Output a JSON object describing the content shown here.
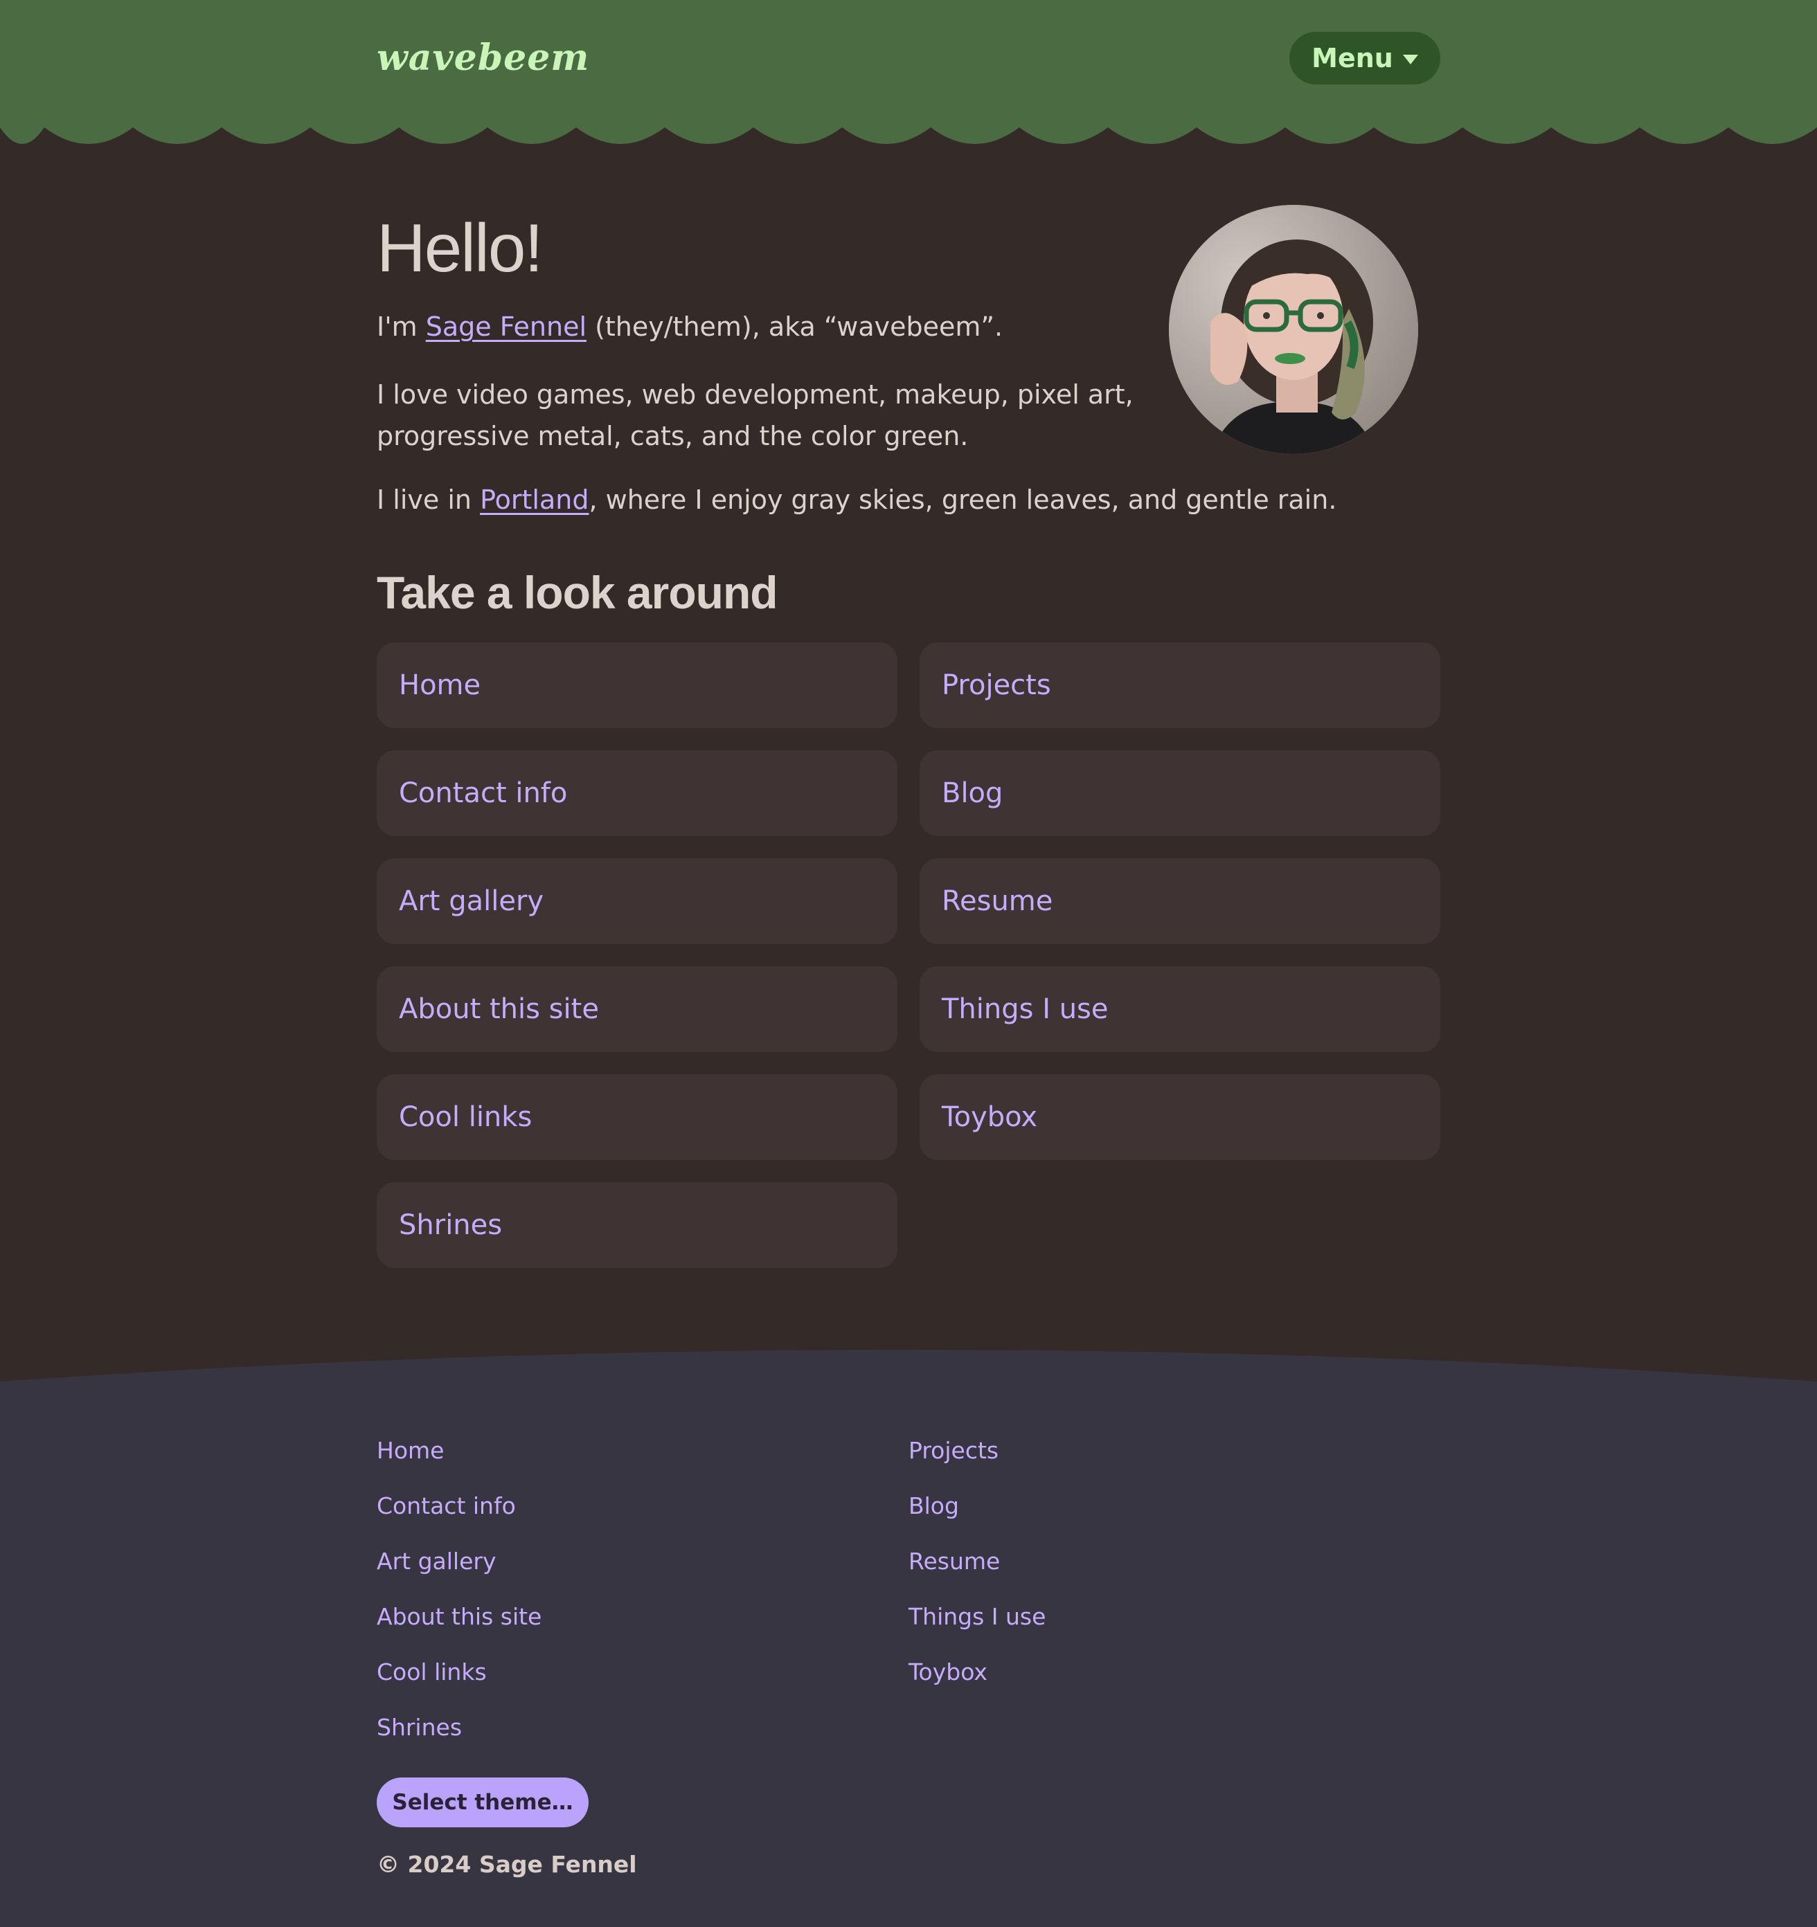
{
  "header": {
    "logo_text": "wavebeem",
    "menu_label": "Menu",
    "menu_icon": "caret-down-icon",
    "colors": {
      "background": "#4b6c42",
      "accent": "#c9f5b8",
      "menu_bg": "#2f5428"
    }
  },
  "intro": {
    "heading": "Hello!",
    "line1_prefix": "I'm ",
    "line1_link": "Sage Fennel",
    "line1_suffix": " (they/them), aka “wavebeem”.",
    "line2": "I love video games, web development, makeup, pixel art, progressive metal, cats, and the color green.",
    "line3_prefix": "I live in ",
    "line3_link": "Portland",
    "line3_suffix": ", where I enjoy gray skies, green leaves, and gentle rain.",
    "avatar_alt": "profile-photo"
  },
  "look_around": {
    "heading": "Take a look around",
    "cards": [
      "Home",
      "Projects",
      "Contact info",
      "Blog",
      "Art gallery",
      "Resume",
      "About this site",
      "Things I use",
      "Cool links",
      "Toybox",
      "Shrines"
    ]
  },
  "footer": {
    "left_links": [
      "Home",
      "Contact info",
      "Art gallery",
      "About this site",
      "Cool links",
      "Shrines"
    ],
    "right_links": [
      "Projects",
      "Blog",
      "Resume",
      "Things I use",
      "Toybox"
    ],
    "theme_button": "Select theme…",
    "copyright": "© 2024 Sage Fennel",
    "colors": {
      "background": "#373541",
      "link": "#c7acfc",
      "button_bg": "#b9a3fb"
    }
  },
  "colors": {
    "page_bg": "#342a28",
    "text": "#ddd2cc",
    "link": "#c7acfc",
    "card_bg": "#3f3433"
  }
}
